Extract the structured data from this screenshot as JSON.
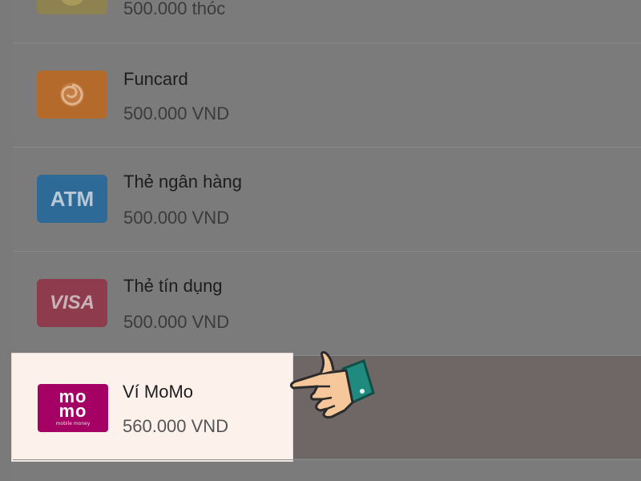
{
  "items": [
    {
      "name": "",
      "amount": "500.000 thóc",
      "icon": "coin-icon"
    },
    {
      "name": "Funcard",
      "amount": "500.000 VND",
      "icon": "funcard-swirl-icon"
    },
    {
      "name": "Thẻ ngân hàng",
      "amount": "500.000 VND",
      "icon": "atm-icon",
      "icon_text": "ATM"
    },
    {
      "name": "Thẻ tín dụng",
      "amount": "500.000 VND",
      "icon": "visa-icon",
      "icon_text": "VISA"
    },
    {
      "name": "Ví MoMo",
      "amount": "560.000 VND",
      "icon": "momo-icon",
      "icon_text": "mo mo",
      "icon_subtext": "mobile money",
      "selected": true
    }
  ],
  "momo_logo": {
    "line1": "mo",
    "line2": "mo"
  },
  "colors": {
    "momo": "#a50064",
    "funcard": "#b46a2a",
    "atm": "#2d6a97",
    "visa": "#8e3c4d",
    "highlight_bg": "#fdf1ec"
  },
  "pointer": {
    "icon": "pointing-hand-icon"
  }
}
